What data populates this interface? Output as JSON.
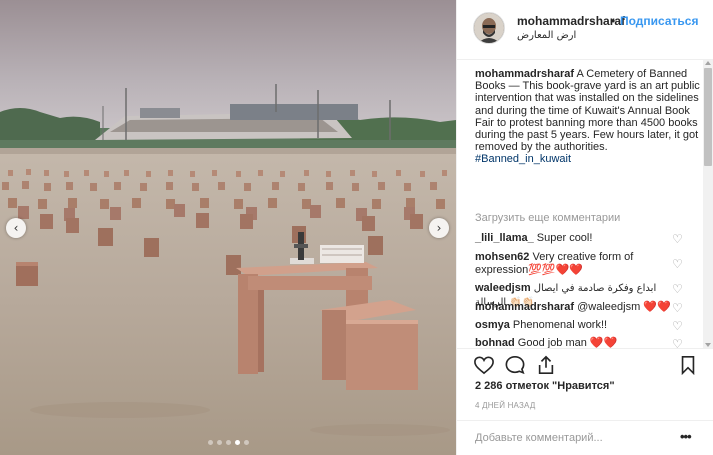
{
  "post": {
    "username": "mohammadrsharaf",
    "bullet": "•",
    "follow_label": "Подписаться",
    "location": "ارض المعارض",
    "caption_user": "mohammadrsharaf",
    "caption_text": "A Cemetery of Banned Books — This book-grave yard is an art public intervention that was installed on the sidelines and during the time of Kuwait's Annual Book Fair to protest banning more than 4500 books during the past 5 years. Few hours later, it got removed by the authorities.",
    "hashtag": "#Banned_in_kuwait",
    "load_more": "Загрузить еще комментарии",
    "likes": "2 286 отметок \"Нравится\"",
    "time": "4 ДНЕЙ НАЗАД",
    "add_comment_placeholder": "Добавьте комментарий...",
    "more": "•••"
  },
  "comments": [
    {
      "user": "_lili_llama_",
      "text": "Super cool!"
    },
    {
      "user": "mohsen62",
      "text": "Very creative form of expression💯💯❤️❤️"
    },
    {
      "user": "waleedjsm",
      "text": "ابداع وفكرة صادمة في ايصال الرسالة 👏🏻👏🏻"
    },
    {
      "user": "mohammadrsharaf",
      "text": "@waleedjsm ❤️❤️"
    },
    {
      "user": "osmya",
      "text": "Phenomenal work!!"
    },
    {
      "user": "bohnad",
      "text": "Good job man ❤️❤️"
    }
  ],
  "carousel": {
    "prev_icon": "chevron-left-icon",
    "next_icon": "chevron-right-icon",
    "prev_glyph": "‹",
    "next_glyph": "›",
    "dot_count": 5,
    "active_dot": 3
  },
  "icons": {
    "heart": "heart-icon",
    "comment": "comment-bubble-icon",
    "share": "share-icon",
    "save": "bookmark-icon",
    "heart_glyph": "♡"
  },
  "colors": {
    "link": "#3897f0",
    "hashtag": "#003569",
    "muted": "#999999",
    "text": "#262626"
  }
}
